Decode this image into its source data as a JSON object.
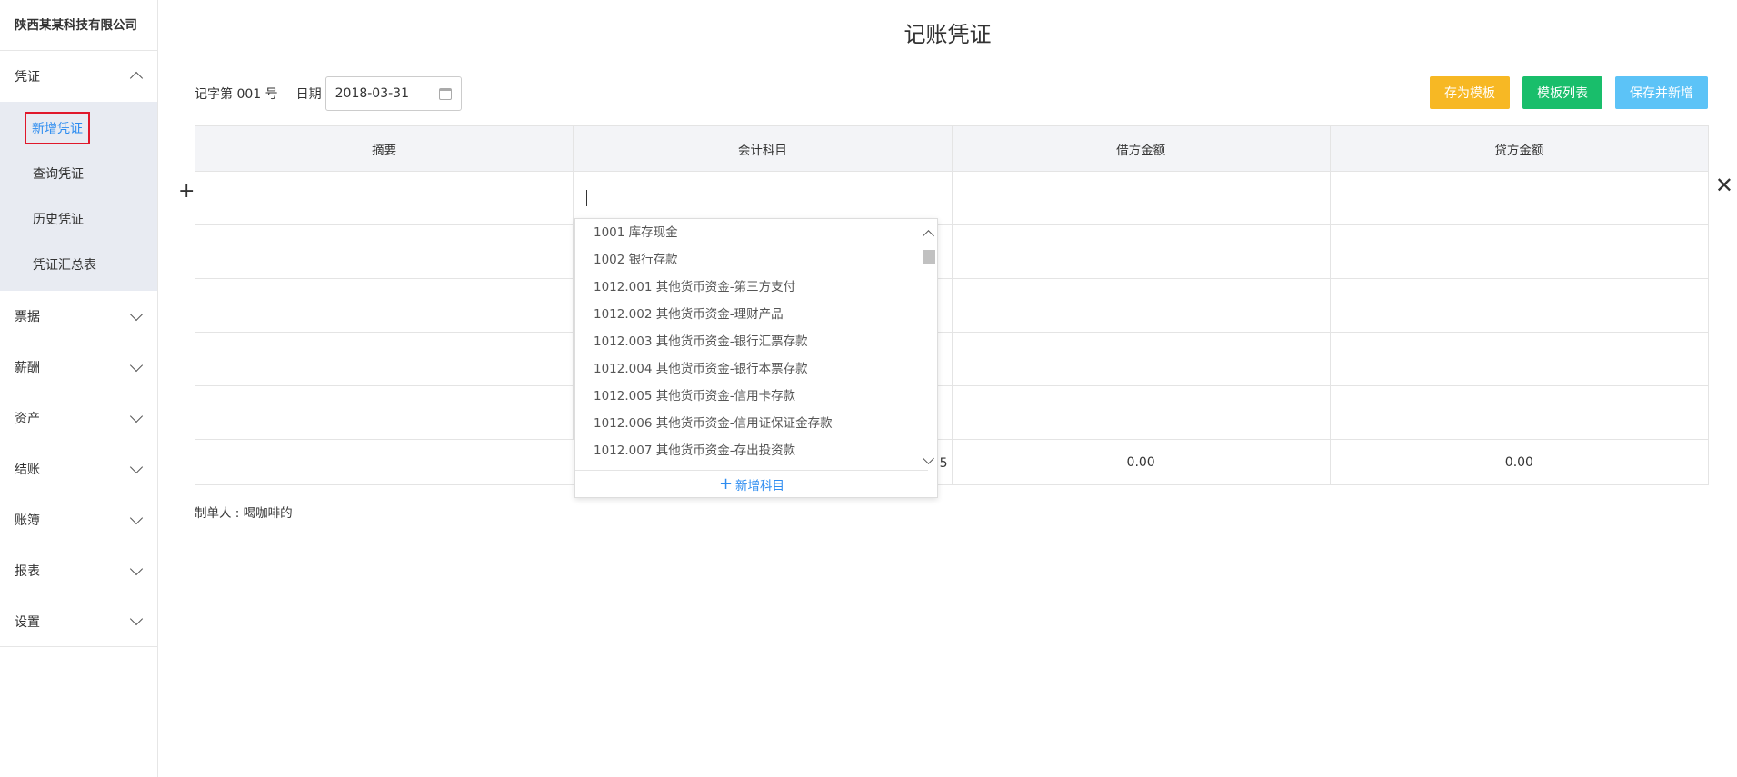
{
  "sidebar": {
    "company": "陕西某某科技有限公司",
    "voucher_menu": {
      "label": "凭证",
      "items": [
        "新增凭证",
        "查询凭证",
        "历史凭证",
        "凭证汇总表"
      ]
    },
    "menus": [
      "票据",
      "薪酬",
      "资产",
      "结账",
      "账簿",
      "报表",
      "设置"
    ]
  },
  "page": {
    "title": "记账凭证",
    "voucher_no": "记字第 001 号",
    "date_label": "日期",
    "date_value": "2018-03-31"
  },
  "buttons": {
    "save_template": "存为模板",
    "template_list": "模板列表",
    "save_new": "保存并新增"
  },
  "table": {
    "headers": [
      "摘要",
      "会计科目",
      "借方金额",
      "贷方金额"
    ],
    "total_label": "总计: 5",
    "debit_total": "0.00",
    "credit_total": "0.00"
  },
  "dropdown": {
    "options": [
      "1001 库存现金",
      "1002 银行存款",
      "1012.001 其他货币资金-第三方支付",
      "1012.002 其他货币资金-理财产品",
      "1012.003 其他货币资金-银行汇票存款",
      "1012.004 其他货币资金-银行本票存款",
      "1012.005 其他货币资金-信用卡存款",
      "1012.006 其他货币资金-信用证保证金存款",
      "1012.007 其他货币资金-存出投资款"
    ],
    "add_label": "新增科目"
  },
  "footer": {
    "maker": "制单人 : 喝咖啡的"
  },
  "colors": {
    "accent_blue": "#2d8cf0",
    "orange": "#f7b824",
    "green": "#19be6b",
    "light_blue": "#5cc3f7",
    "highlight_red": "#e0182b"
  }
}
